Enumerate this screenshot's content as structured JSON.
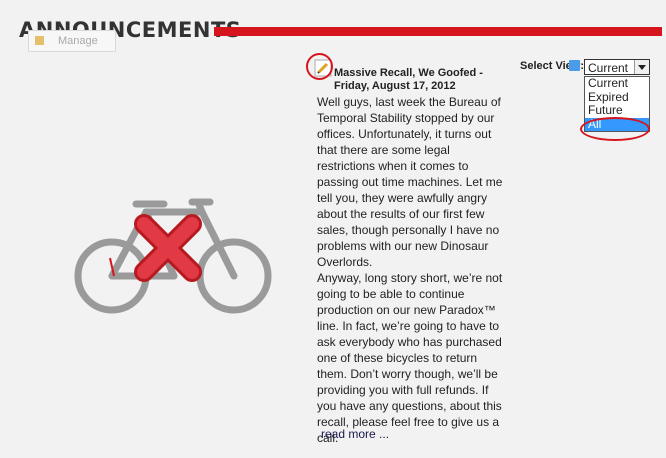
{
  "header": {
    "title": "ANNOUNCEMENTS"
  },
  "toolbar": {
    "manage_label": "Manage"
  },
  "post": {
    "title": "Massive Recall, We Goofed - Friday, August 17, 2012",
    "paragraphs": [
      "Well guys, last week the Bureau of Temporal Stability stopped by our offices. Unfortunately, it turns out that there are some legal restrictions when it comes to passing out time machines. Let me tell you, they were awfully angry about the results of our first few sales, though personally I have no problems with our new Dinosaur Overlords.",
      "Anyway, long story short, we’re not going to be able to continue production on our new Paradox™ line. In fact, we’re going to have to ask everybody who has purchased one of these bicycles to return them. Don’t worry though, we’ll be providing you with full refunds. If you have any questions, about this recall, please feel free to give us a call."
    ],
    "read_more": "read more ..."
  },
  "view_selector": {
    "label": "Select View:",
    "current_value": "Current",
    "options": [
      "Current",
      "Expired",
      "Future",
      "All"
    ],
    "highlighted_option": "All"
  },
  "icons": {
    "edit": "edit-pencil-icon",
    "bike": "bicycle-icon",
    "error_x": "red-x-icon",
    "info": "info-icon"
  },
  "colors": {
    "accent_red": "#d6141d",
    "selection_blue": "#3399ff",
    "bike_gray": "#9a9a9a"
  }
}
